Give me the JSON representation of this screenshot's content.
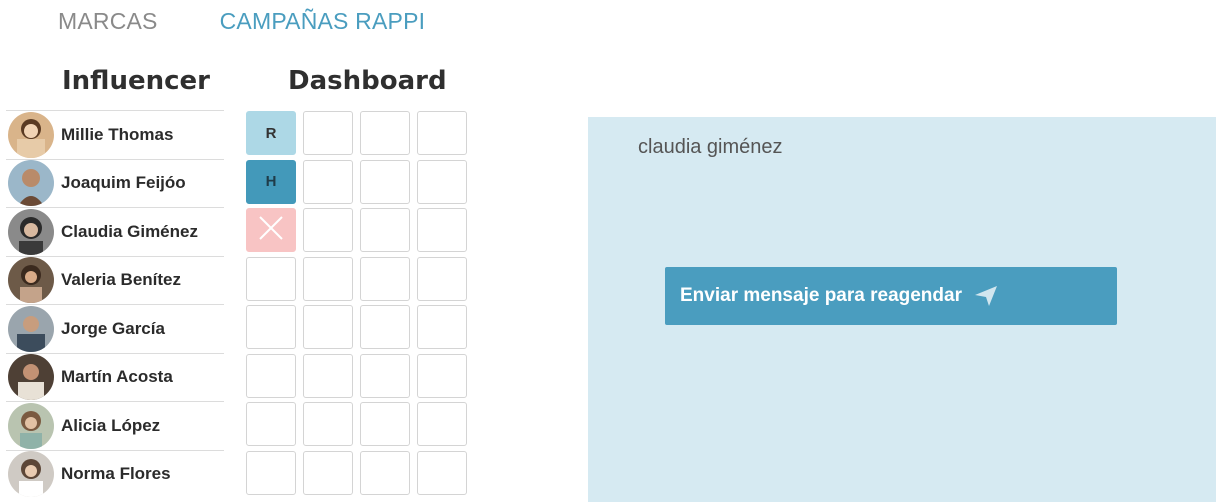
{
  "nav": {
    "tab_marcas": "MARCAS",
    "tab_campanas": "CAMPAÑAS RAPPI"
  },
  "headings": {
    "influencer": "Influencer",
    "dashboard": "Dashboard"
  },
  "influencers": [
    {
      "name": "Millie Thomas"
    },
    {
      "name": "Joaquim Feijóo"
    },
    {
      "name": "Claudia Giménez"
    },
    {
      "name": "Valeria Benítez"
    },
    {
      "name": "Jorge García"
    },
    {
      "name": "Martín Acosta"
    },
    {
      "name": "Alicia López"
    },
    {
      "name": "Norma Flores"
    }
  ],
  "dashboard": {
    "row0": {
      "c0": "R"
    },
    "row1": {
      "c0": "H"
    },
    "status_icons": {
      "row2_c0": "close-icon"
    }
  },
  "panel": {
    "selected_name": "claudia giménez",
    "send_button": "Enviar mensaje para reagendar",
    "send_icon": "send-icon"
  },
  "colors": {
    "accent": "#4a9dbf",
    "panel_bg": "#d6eaf2",
    "state_r": "#add8e6",
    "state_h": "#4399ba",
    "state_x": "#f8c4c4"
  }
}
